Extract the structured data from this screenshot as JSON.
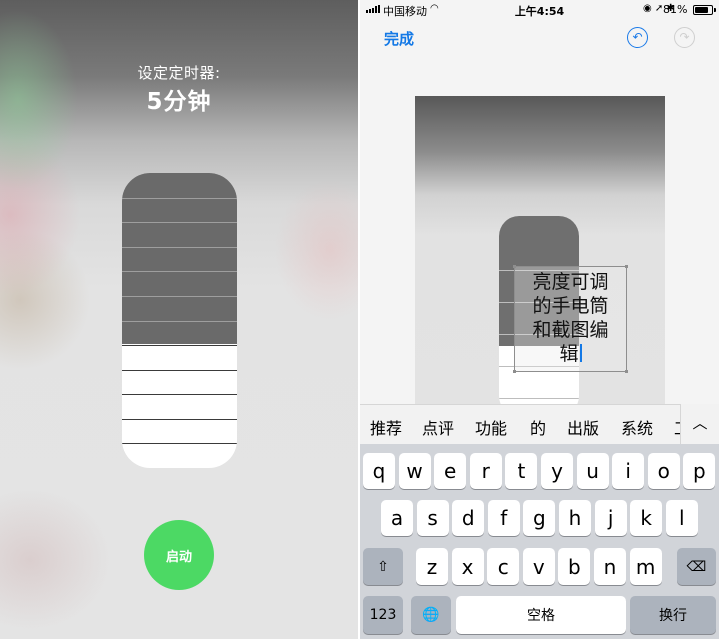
{
  "left": {
    "timer_heading": "设定定时器:",
    "timer_value": "5分钟",
    "slider": {
      "segments": 12,
      "lit_segments": 5,
      "level_fraction": 0.42
    },
    "start_label": "启动"
  },
  "right": {
    "status_bar": {
      "carrier": "中国移动",
      "time": "上午4:54",
      "icons": "◉ ➚ ✱",
      "battery_text": "81%",
      "battery_level": 0.81
    },
    "nav": {
      "done_label": "完成",
      "undo_icon": "undo-icon",
      "redo_icon": "redo-icon"
    },
    "overlay_text": {
      "line1": "亮度可调",
      "line2": "的手电筒",
      "line3": "和截图编",
      "line4": "辑"
    },
    "suggestions": [
      "推荐",
      "点评",
      "功能",
      "的",
      "出版",
      "系统",
      "工"
    ],
    "collapse_icon": "chevron-up-icon",
    "keyboard": {
      "row1": [
        "q",
        "w",
        "e",
        "r",
        "t",
        "y",
        "u",
        "i",
        "o",
        "p"
      ],
      "row2": [
        "a",
        "s",
        "d",
        "f",
        "g",
        "h",
        "j",
        "k",
        "l"
      ],
      "row3": [
        "z",
        "x",
        "c",
        "v",
        "b",
        "n",
        "m"
      ],
      "shift_icon": "⇧",
      "delete_icon": "⌫",
      "numbers_label": "123",
      "globe_icon": "🌐",
      "space_label": "空格",
      "return_label": "换行"
    }
  },
  "colors": {
    "accent": "#1479e6",
    "start_green": "#4cd964",
    "key_bg": "#ffffff",
    "keyboard_bg": "#d1d4d9"
  }
}
